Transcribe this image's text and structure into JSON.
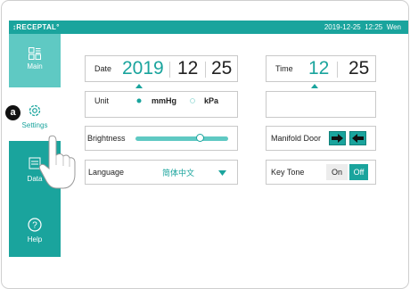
{
  "header": {
    "brand": "↕RECEPTAL°",
    "date": "2019-12-25",
    "time": "12:25",
    "weekday": "Wen"
  },
  "sidebar": {
    "items": [
      {
        "label": "Main",
        "icon": "grid-list-icon"
      },
      {
        "label": "Settings",
        "icon": "gear-icon"
      },
      {
        "label": "Data",
        "icon": "data-icon"
      },
      {
        "label": "Help",
        "icon": "help-circle-icon"
      }
    ]
  },
  "annotation": {
    "marker": "a"
  },
  "settings": {
    "date": {
      "label": "Date",
      "year": "2019",
      "month": "12",
      "day": "25"
    },
    "time": {
      "label": "Time",
      "hour": "12",
      "minute": "25"
    },
    "unit": {
      "label": "Unit",
      "option1": "mmHg",
      "option2": "kPa",
      "selected": "mmHg"
    },
    "brightness": {
      "label": "Brightness",
      "level": 0.7
    },
    "manifold_door": {
      "label": "Manifold Door"
    },
    "language": {
      "label": "Language",
      "value": "简体中文"
    },
    "key_tone": {
      "label": "Key Tone",
      "on": "On",
      "off": "Off",
      "selected": "Off"
    }
  },
  "colors": {
    "accent": "#1aa49d",
    "light_accent": "#5fc9c3",
    "badge": "#111111"
  }
}
